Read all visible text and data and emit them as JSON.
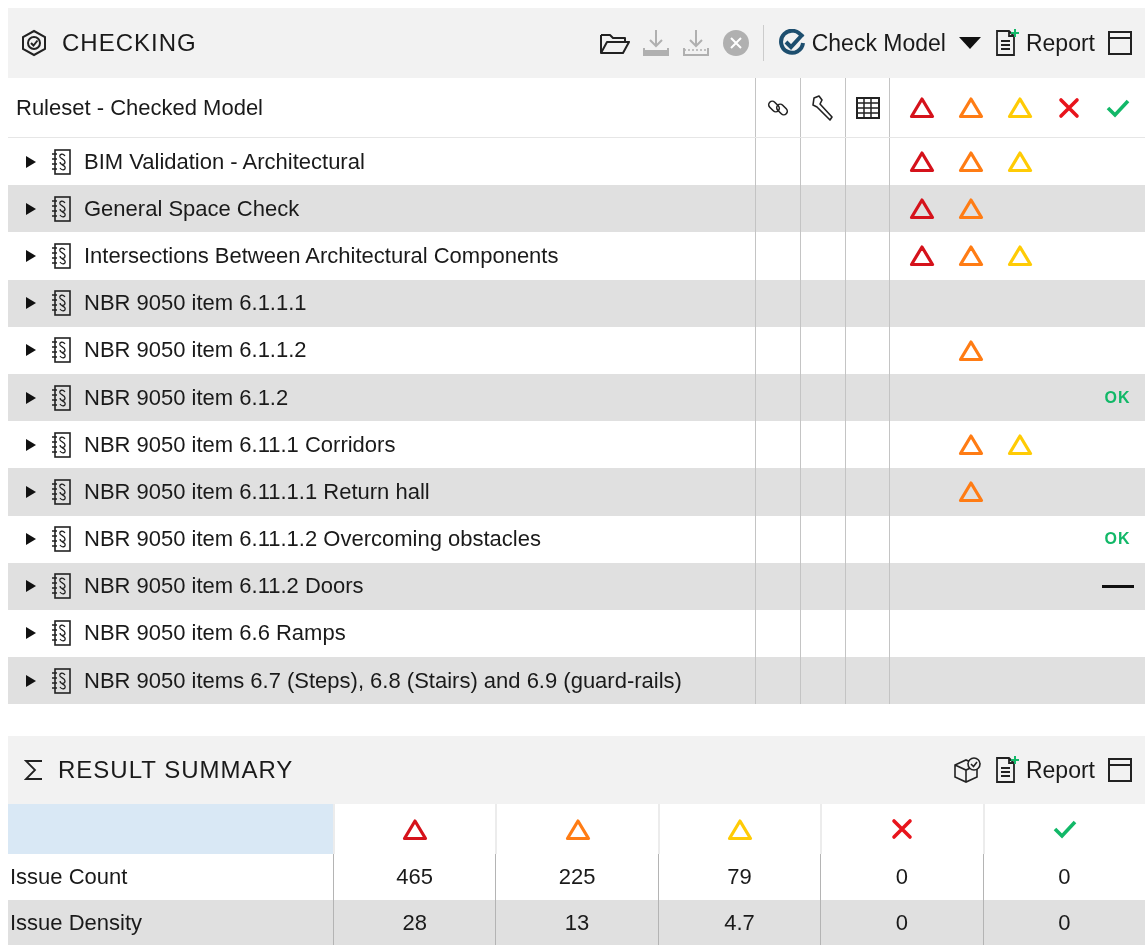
{
  "checking": {
    "title": "CHECKING",
    "toolbar": [
      {
        "kind": "open",
        "disabled": false
      },
      {
        "kind": "download",
        "disabled": true
      },
      {
        "kind": "download-all",
        "disabled": true
      },
      {
        "kind": "stop",
        "disabled": true
      }
    ],
    "check_button": {
      "label": "Check Model"
    },
    "report_button": {
      "label": "Report"
    },
    "columns": {
      "name": "Ruleset - Checked Model"
    },
    "severities": [
      {
        "kind": "triangle",
        "color": "#d5121b"
      },
      {
        "kind": "triangle",
        "color": "#ff7c14"
      },
      {
        "kind": "triangle",
        "color": "#ffcb05"
      },
      {
        "kind": "cross",
        "color": "#e8141c"
      },
      {
        "kind": "check",
        "color": "#12b868"
      }
    ],
    "rows": [
      {
        "label": "BIM Validation - Architectural",
        "expanded": false,
        "flags": [
          true,
          true,
          true
        ]
      },
      {
        "label": "General Space Check",
        "expanded": false,
        "flags": [
          true,
          true,
          false
        ]
      },
      {
        "label": "Intersections Between Architectural Components",
        "expanded": false,
        "flags": [
          true,
          true,
          true
        ]
      },
      {
        "label": "NBR 9050 item 6.1.1.1",
        "expanded": false,
        "flags": [
          false,
          false,
          false
        ]
      },
      {
        "label": "NBR 9050 item 6.1.1.2",
        "expanded": false,
        "flags": [
          false,
          true,
          false
        ]
      },
      {
        "label": "NBR 9050 item 6.1.2",
        "expanded": false,
        "flags": [
          false,
          false,
          false
        ],
        "result": {
          "kind": "ok",
          "text": "OK"
        }
      },
      {
        "label": "NBR 9050 item 6.11.1 Corridors",
        "expanded": false,
        "flags": [
          false,
          true,
          true
        ]
      },
      {
        "label": "NBR 9050 item 6.11.1.1 Return hall",
        "expanded": false,
        "flags": [
          false,
          true,
          false
        ]
      },
      {
        "label": "NBR 9050 item 6.11.1.2 Overcoming obstacles",
        "expanded": false,
        "flags": [
          false,
          false,
          false
        ],
        "result": {
          "kind": "ok",
          "text": "OK"
        }
      },
      {
        "label": "NBR 9050 item 6.11.2 Doors",
        "expanded": false,
        "flags": [
          false,
          false,
          false
        ],
        "result": {
          "kind": "dash"
        }
      },
      {
        "label": "NBR 9050 item 6.6 Ramps",
        "expanded": false,
        "flags": [
          false,
          false,
          false
        ]
      },
      {
        "label": "NBR 9050 items 6.7 (Steps), 6.8 (Stairs) and 6.9 (guard-rails)",
        "expanded": false,
        "flags": [
          false,
          false,
          false
        ]
      }
    ]
  },
  "result_summary": {
    "title": "RESULT SUMMARY",
    "report_button": {
      "label": "Report"
    },
    "rows": [
      {
        "label": "Issue Count",
        "values": [
          "465",
          "225",
          "79",
          "0",
          "0"
        ]
      },
      {
        "label": "Issue Density",
        "values": [
          "28",
          "13",
          "4.7",
          "0",
          "0"
        ]
      }
    ]
  }
}
